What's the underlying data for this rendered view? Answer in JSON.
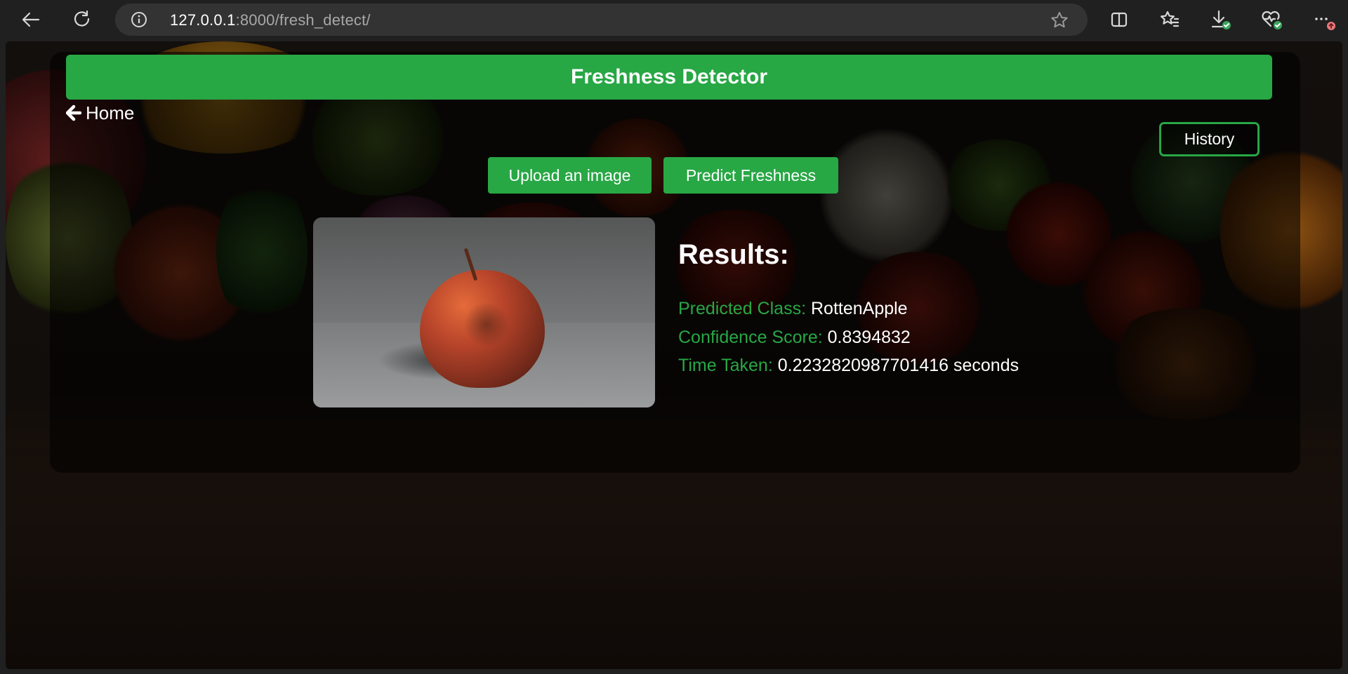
{
  "browser": {
    "url_host": "127.0.0.1",
    "url_rest": ":8000/fresh_detect/",
    "icons": [
      "back-arrow-icon",
      "reload-icon",
      "info-icon",
      "favorite-star-icon",
      "split-screen-icon",
      "favorites-icon",
      "downloads-icon",
      "browser-essentials-icon",
      "more-menu-icon"
    ]
  },
  "page": {
    "title": "Freshness Detector",
    "home_label": "Home",
    "history_label": "History",
    "upload_label": "Upload an image",
    "predict_label": "Predict Freshness",
    "results_heading": "Results:",
    "results": [
      {
        "label": "Predicted Class:",
        "value": "RottenApple"
      },
      {
        "label": "Confidence Score:",
        "value": "0.8394832"
      },
      {
        "label": "Time Taken:",
        "value": "0.2232820987701416 seconds"
      }
    ]
  },
  "colors": {
    "accent": "#28a745",
    "chrome": "#202020",
    "omnibox": "#333333"
  }
}
